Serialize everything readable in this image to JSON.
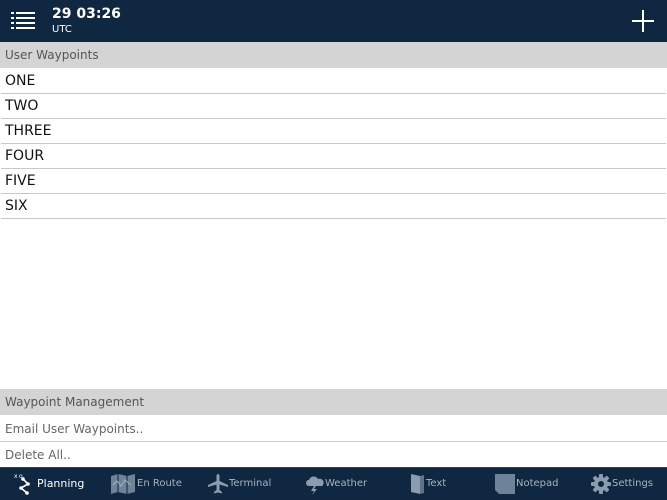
{
  "header": {
    "time": "29 03:26",
    "timezone": "UTC"
  },
  "user_waypoints": {
    "title": "User Waypoints",
    "items": [
      "ONE",
      "TWO",
      "THREE",
      "FOUR",
      "FIVE",
      "SIX"
    ]
  },
  "management": {
    "title": "Waypoint Management",
    "email": "Email User Waypoints..",
    "delete": "Delete All.."
  },
  "tabs": [
    {
      "label": "Planning",
      "icon": "planning-icon",
      "active": true
    },
    {
      "label": "En Route",
      "icon": "map-icon",
      "active": false
    },
    {
      "label": "Terminal",
      "icon": "airplane-icon",
      "active": false
    },
    {
      "label": "Weather",
      "icon": "cloud-lightning-icon",
      "active": false
    },
    {
      "label": "Text",
      "icon": "document-icon",
      "active": false
    },
    {
      "label": "Notepad",
      "icon": "notepad-icon",
      "active": false
    },
    {
      "label": "Settings",
      "icon": "gear-icon",
      "active": false
    }
  ],
  "colors": {
    "bar": "#0f2740",
    "section": "#d4d4d4",
    "tab_inactive": "#a7b4c2"
  }
}
